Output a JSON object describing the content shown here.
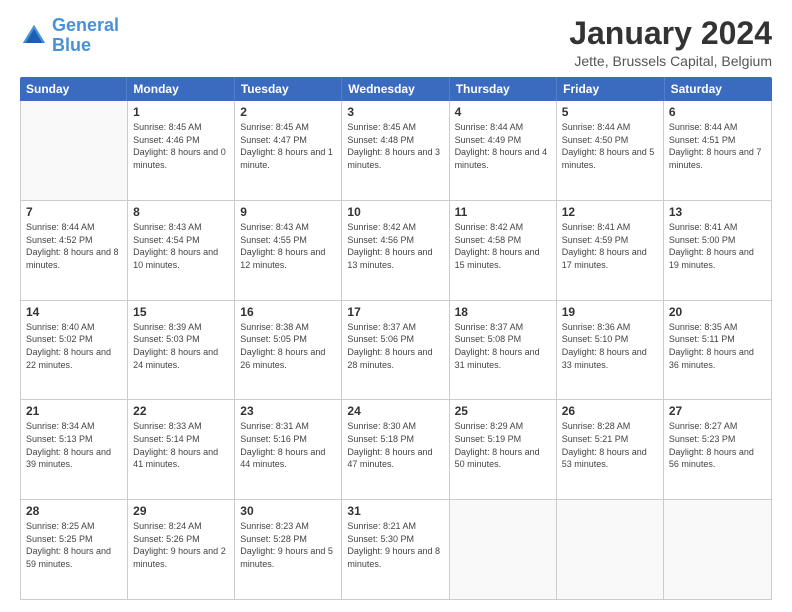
{
  "logo": {
    "line1": "General",
    "line2": "Blue"
  },
  "title": "January 2024",
  "subtitle": "Jette, Brussels Capital, Belgium",
  "headers": [
    "Sunday",
    "Monday",
    "Tuesday",
    "Wednesday",
    "Thursday",
    "Friday",
    "Saturday"
  ],
  "weeks": [
    [
      {
        "day": "",
        "sunrise": "",
        "sunset": "",
        "daylight": "",
        "empty": true
      },
      {
        "day": "1",
        "sunrise": "Sunrise: 8:45 AM",
        "sunset": "Sunset: 4:46 PM",
        "daylight": "Daylight: 8 hours and 0 minutes."
      },
      {
        "day": "2",
        "sunrise": "Sunrise: 8:45 AM",
        "sunset": "Sunset: 4:47 PM",
        "daylight": "Daylight: 8 hours and 1 minute."
      },
      {
        "day": "3",
        "sunrise": "Sunrise: 8:45 AM",
        "sunset": "Sunset: 4:48 PM",
        "daylight": "Daylight: 8 hours and 3 minutes."
      },
      {
        "day": "4",
        "sunrise": "Sunrise: 8:44 AM",
        "sunset": "Sunset: 4:49 PM",
        "daylight": "Daylight: 8 hours and 4 minutes."
      },
      {
        "day": "5",
        "sunrise": "Sunrise: 8:44 AM",
        "sunset": "Sunset: 4:50 PM",
        "daylight": "Daylight: 8 hours and 5 minutes."
      },
      {
        "day": "6",
        "sunrise": "Sunrise: 8:44 AM",
        "sunset": "Sunset: 4:51 PM",
        "daylight": "Daylight: 8 hours and 7 minutes."
      }
    ],
    [
      {
        "day": "7",
        "sunrise": "Sunrise: 8:44 AM",
        "sunset": "Sunset: 4:52 PM",
        "daylight": "Daylight: 8 hours and 8 minutes."
      },
      {
        "day": "8",
        "sunrise": "Sunrise: 8:43 AM",
        "sunset": "Sunset: 4:54 PM",
        "daylight": "Daylight: 8 hours and 10 minutes."
      },
      {
        "day": "9",
        "sunrise": "Sunrise: 8:43 AM",
        "sunset": "Sunset: 4:55 PM",
        "daylight": "Daylight: 8 hours and 12 minutes."
      },
      {
        "day": "10",
        "sunrise": "Sunrise: 8:42 AM",
        "sunset": "Sunset: 4:56 PM",
        "daylight": "Daylight: 8 hours and 13 minutes."
      },
      {
        "day": "11",
        "sunrise": "Sunrise: 8:42 AM",
        "sunset": "Sunset: 4:58 PM",
        "daylight": "Daylight: 8 hours and 15 minutes."
      },
      {
        "day": "12",
        "sunrise": "Sunrise: 8:41 AM",
        "sunset": "Sunset: 4:59 PM",
        "daylight": "Daylight: 8 hours and 17 minutes."
      },
      {
        "day": "13",
        "sunrise": "Sunrise: 8:41 AM",
        "sunset": "Sunset: 5:00 PM",
        "daylight": "Daylight: 8 hours and 19 minutes."
      }
    ],
    [
      {
        "day": "14",
        "sunrise": "Sunrise: 8:40 AM",
        "sunset": "Sunset: 5:02 PM",
        "daylight": "Daylight: 8 hours and 22 minutes."
      },
      {
        "day": "15",
        "sunrise": "Sunrise: 8:39 AM",
        "sunset": "Sunset: 5:03 PM",
        "daylight": "Daylight: 8 hours and 24 minutes."
      },
      {
        "day": "16",
        "sunrise": "Sunrise: 8:38 AM",
        "sunset": "Sunset: 5:05 PM",
        "daylight": "Daylight: 8 hours and 26 minutes."
      },
      {
        "day": "17",
        "sunrise": "Sunrise: 8:37 AM",
        "sunset": "Sunset: 5:06 PM",
        "daylight": "Daylight: 8 hours and 28 minutes."
      },
      {
        "day": "18",
        "sunrise": "Sunrise: 8:37 AM",
        "sunset": "Sunset: 5:08 PM",
        "daylight": "Daylight: 8 hours and 31 minutes."
      },
      {
        "day": "19",
        "sunrise": "Sunrise: 8:36 AM",
        "sunset": "Sunset: 5:10 PM",
        "daylight": "Daylight: 8 hours and 33 minutes."
      },
      {
        "day": "20",
        "sunrise": "Sunrise: 8:35 AM",
        "sunset": "Sunset: 5:11 PM",
        "daylight": "Daylight: 8 hours and 36 minutes."
      }
    ],
    [
      {
        "day": "21",
        "sunrise": "Sunrise: 8:34 AM",
        "sunset": "Sunset: 5:13 PM",
        "daylight": "Daylight: 8 hours and 39 minutes."
      },
      {
        "day": "22",
        "sunrise": "Sunrise: 8:33 AM",
        "sunset": "Sunset: 5:14 PM",
        "daylight": "Daylight: 8 hours and 41 minutes."
      },
      {
        "day": "23",
        "sunrise": "Sunrise: 8:31 AM",
        "sunset": "Sunset: 5:16 PM",
        "daylight": "Daylight: 8 hours and 44 minutes."
      },
      {
        "day": "24",
        "sunrise": "Sunrise: 8:30 AM",
        "sunset": "Sunset: 5:18 PM",
        "daylight": "Daylight: 8 hours and 47 minutes."
      },
      {
        "day": "25",
        "sunrise": "Sunrise: 8:29 AM",
        "sunset": "Sunset: 5:19 PM",
        "daylight": "Daylight: 8 hours and 50 minutes."
      },
      {
        "day": "26",
        "sunrise": "Sunrise: 8:28 AM",
        "sunset": "Sunset: 5:21 PM",
        "daylight": "Daylight: 8 hours and 53 minutes."
      },
      {
        "day": "27",
        "sunrise": "Sunrise: 8:27 AM",
        "sunset": "Sunset: 5:23 PM",
        "daylight": "Daylight: 8 hours and 56 minutes."
      }
    ],
    [
      {
        "day": "28",
        "sunrise": "Sunrise: 8:25 AM",
        "sunset": "Sunset: 5:25 PM",
        "daylight": "Daylight: 8 hours and 59 minutes."
      },
      {
        "day": "29",
        "sunrise": "Sunrise: 8:24 AM",
        "sunset": "Sunset: 5:26 PM",
        "daylight": "Daylight: 9 hours and 2 minutes."
      },
      {
        "day": "30",
        "sunrise": "Sunrise: 8:23 AM",
        "sunset": "Sunset: 5:28 PM",
        "daylight": "Daylight: 9 hours and 5 minutes."
      },
      {
        "day": "31",
        "sunrise": "Sunrise: 8:21 AM",
        "sunset": "Sunset: 5:30 PM",
        "daylight": "Daylight: 9 hours and 8 minutes."
      },
      {
        "day": "",
        "sunrise": "",
        "sunset": "",
        "daylight": "",
        "empty": true
      },
      {
        "day": "",
        "sunrise": "",
        "sunset": "",
        "daylight": "",
        "empty": true
      },
      {
        "day": "",
        "sunrise": "",
        "sunset": "",
        "daylight": "",
        "empty": true
      }
    ]
  ]
}
